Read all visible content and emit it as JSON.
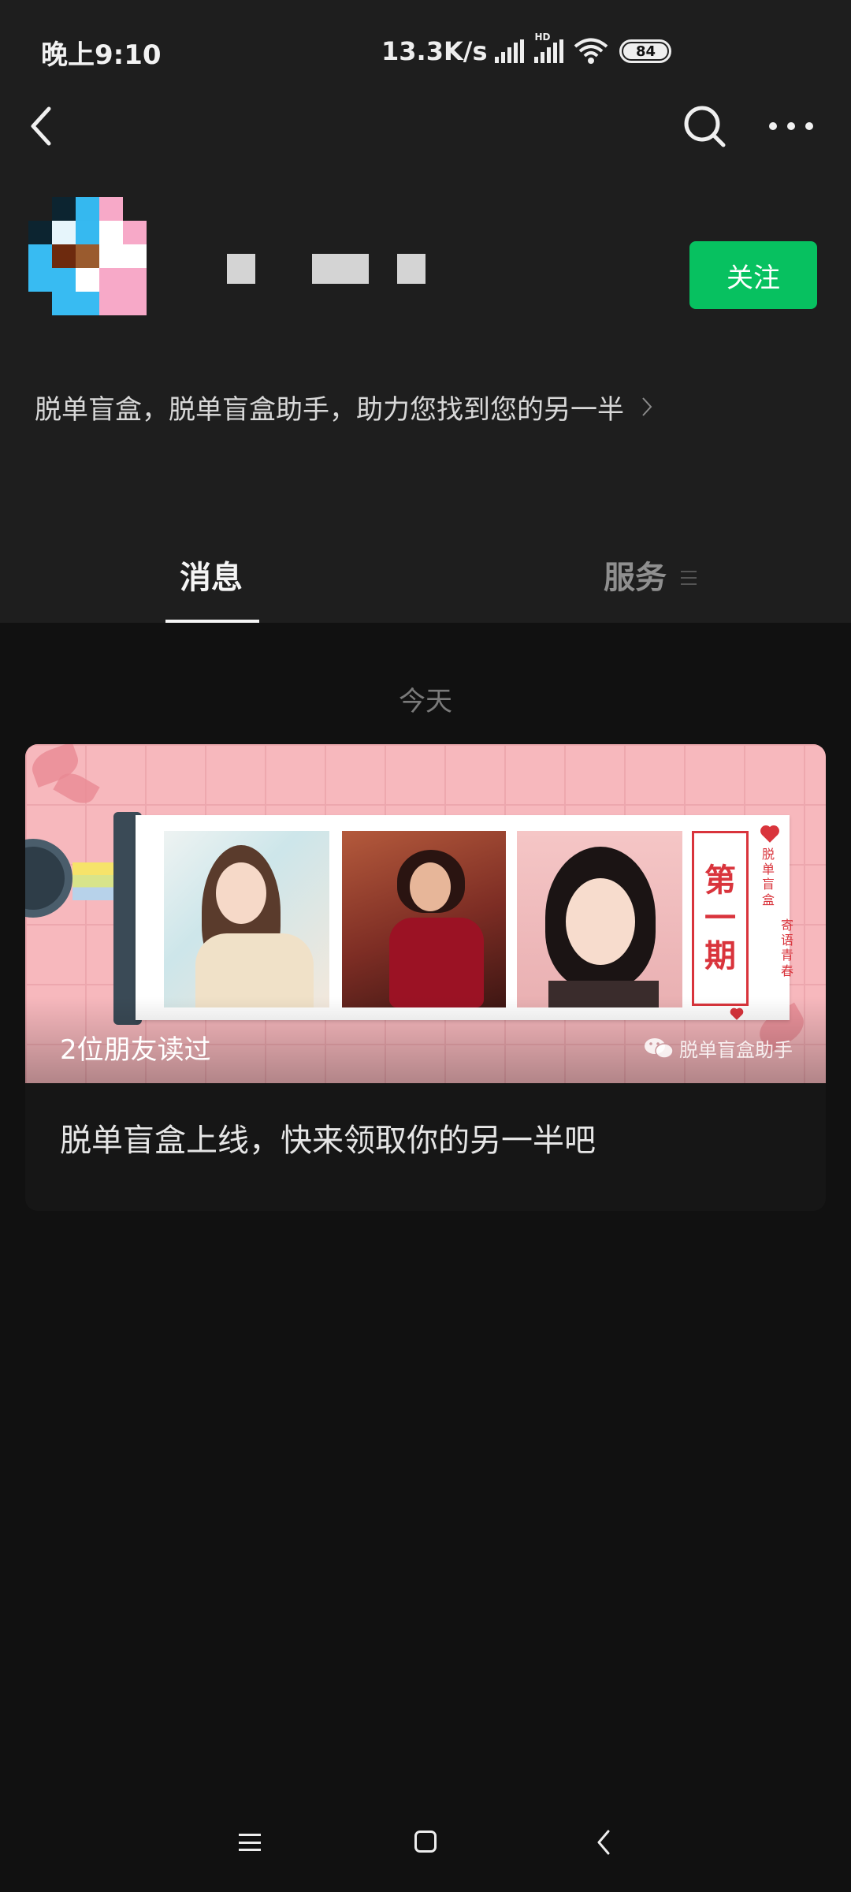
{
  "status_bar": {
    "time": "晚上9:10",
    "network_speed": "13.3K/s",
    "hd_label": "HD",
    "battery_level": "84"
  },
  "nav": {
    "back_icon": "back-arrow-icon",
    "search_icon": "search-icon",
    "more_icon": "more-icon"
  },
  "profile": {
    "follow_label": "关注",
    "bio": "脱单盲盒，脱单盲盒助手，助力您找到您的另一半"
  },
  "tabs": [
    {
      "label": "消息",
      "active": true
    },
    {
      "label": "服务",
      "active": false
    }
  ],
  "date_label": "今天",
  "article": {
    "read_count": "2位朋友读过",
    "watermark": "脱单盲盒助手",
    "issue_line1": "第",
    "issue_line2": "一",
    "issue_line3": "期",
    "side_text_1": "脱单盲盒",
    "side_text_2": "寄语青春",
    "title": "脱单盲盒上线，快来领取你的另一半吧"
  },
  "colors": {
    "accent": "#07c160",
    "background": "#111111",
    "header_background": "#1e1e1e",
    "cover_pink": "#f7b8bd",
    "issue_red": "#d9343c"
  }
}
